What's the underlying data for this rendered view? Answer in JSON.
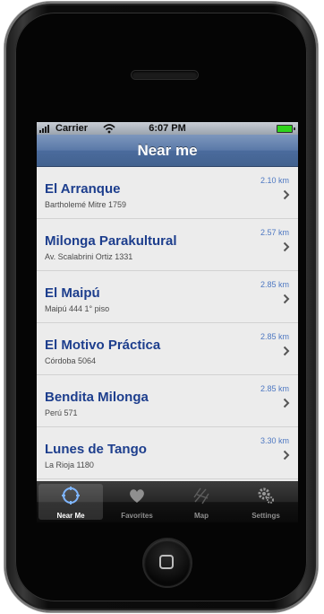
{
  "status_bar": {
    "carrier": "Carrier",
    "time": "6:07 PM"
  },
  "nav": {
    "title": "Near me"
  },
  "venues": [
    {
      "name": "El Arranque",
      "address": "Bartholemé Mitre 1759",
      "distance": "2.10 km"
    },
    {
      "name": "Milonga Parakultural",
      "address": "Av. Scalabrini Ortiz 1331",
      "distance": "2.57 km"
    },
    {
      "name": "El Maipú",
      "address": "Maipú 444 1° piso",
      "distance": "2.85 km"
    },
    {
      "name": "El Motivo Práctica",
      "address": "Córdoba 5064",
      "distance": "2.85 km"
    },
    {
      "name": "Bendita Milonga",
      "address": "Perú 571",
      "distance": "2.85 km"
    },
    {
      "name": "Lunes de Tango",
      "address": "La Rioja 1180",
      "distance": "3.30 km"
    }
  ],
  "tabs": [
    {
      "label": "Near Me",
      "icon": "compass-icon",
      "active": true
    },
    {
      "label": "Favorites",
      "icon": "heart-icon",
      "active": false
    },
    {
      "label": "Map",
      "icon": "map-icon",
      "active": false
    },
    {
      "label": "Settings",
      "icon": "gear-icon",
      "active": false
    }
  ],
  "colors": {
    "nav_bar": "#4b6b9d",
    "venue_title": "#1d3e8d",
    "distance_text": "#4e78c2",
    "battery": "#2fd31b"
  }
}
